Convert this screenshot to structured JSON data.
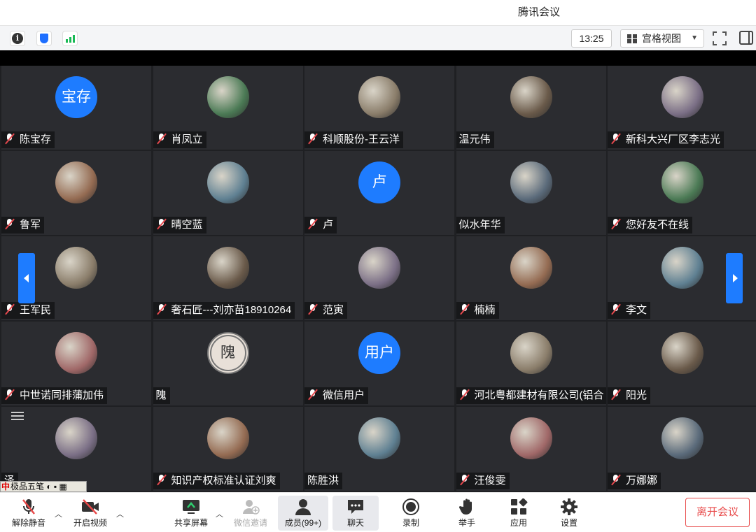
{
  "window": {
    "title": "腾讯会议"
  },
  "toolbar": {
    "time": "13:25",
    "view_mode": "宫格视图",
    "icons": [
      "info-icon",
      "shield-icon",
      "signal-icon",
      "fullscreen-icon",
      "side-panel-icon"
    ]
  },
  "participants": [
    {
      "name": "陈宝存",
      "avatar_text": "宝存",
      "muted": true,
      "avatar_color": "#1e7cff"
    },
    {
      "name": "肖凤立",
      "muted": true
    },
    {
      "name": "科顺股份-王云洋",
      "muted": true
    },
    {
      "name": "温元伟",
      "muted": false
    },
    {
      "name": "新科大兴厂区李志光",
      "muted": true
    },
    {
      "name": "鲁军",
      "muted": true
    },
    {
      "name": "晴空蓝",
      "muted": true
    },
    {
      "name": "卢",
      "avatar_text": "卢",
      "muted": true,
      "avatar_color": "#1e7cff"
    },
    {
      "name": "似水年华",
      "muted": false
    },
    {
      "name": "您好友不在线",
      "muted": true
    },
    {
      "name": "王军民",
      "muted": true
    },
    {
      "name": "奢石匠---刘亦苗18910264",
      "muted": true
    },
    {
      "name": "范寅",
      "muted": true
    },
    {
      "name": "楠楠",
      "muted": true
    },
    {
      "name": "李文",
      "muted": true
    },
    {
      "name": "中世诺同排蒲加伟",
      "muted": true
    },
    {
      "name": "隗",
      "avatar_text": "隗",
      "muted": false
    },
    {
      "name": "微信用户",
      "avatar_text": "用户",
      "muted": true,
      "avatar_color": "#1e7cff"
    },
    {
      "name": "河北粤都建材有限公司(铝合",
      "muted": true
    },
    {
      "name": "阳光",
      "muted": true
    },
    {
      "name": "泽",
      "muted": false
    },
    {
      "name": "知识产权标准认证刘爽",
      "muted": true
    },
    {
      "name": "陈胜洪",
      "muted": false
    },
    {
      "name": "汪俊雯",
      "muted": true
    },
    {
      "name": "万娜娜",
      "muted": true
    }
  ],
  "ime": {
    "logo": "中",
    "text": "极品五笔"
  },
  "bottombar": {
    "unmute": "解除静音",
    "start_video": "开启视频",
    "share_screen": "共享屏幕",
    "invite": "微信邀请",
    "members": "成员(99+)",
    "chat": "聊天",
    "record": "录制",
    "raise_hand": "举手",
    "apps": "应用",
    "settings": "设置",
    "leave": "离开会议"
  },
  "colors": {
    "accent": "#1e7cff",
    "danger": "#e84a4a",
    "tile_bg": "#2b2c30"
  }
}
